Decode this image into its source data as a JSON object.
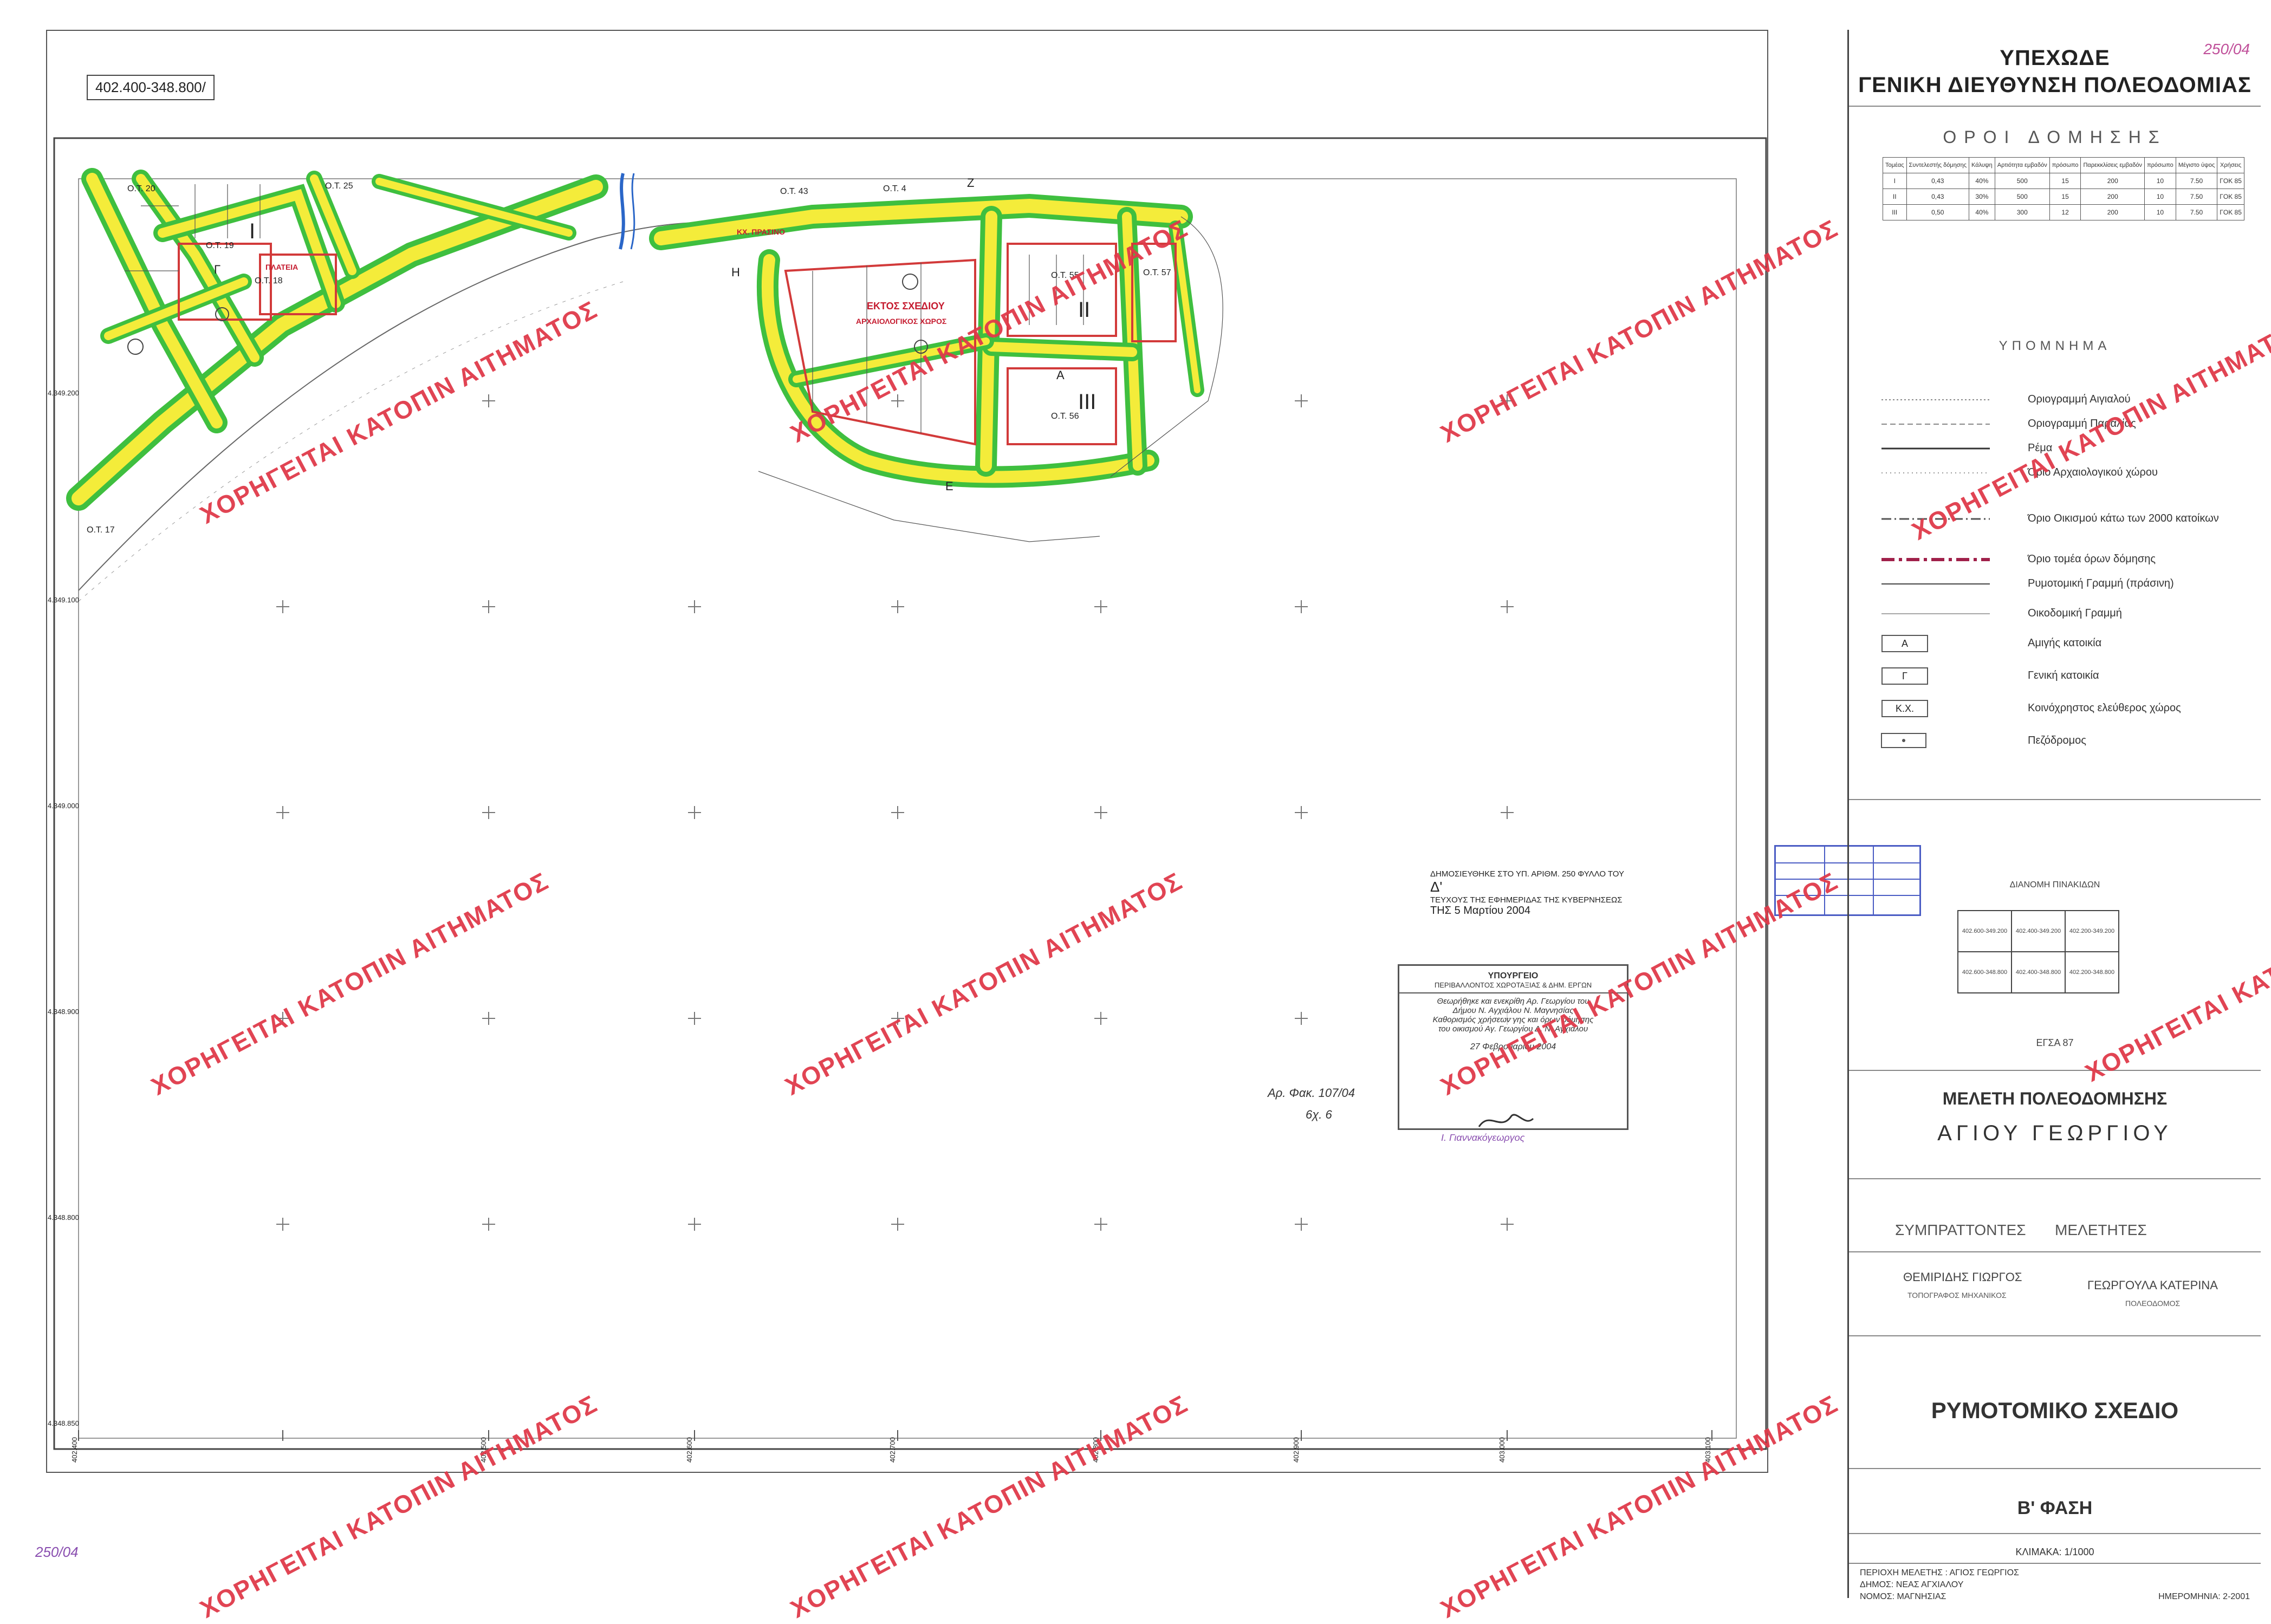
{
  "map_sheet": {
    "coord_ref": "402.400-348.800/",
    "lat_ticks": [
      "4.349.100",
      "4.349.200",
      "4.349.000",
      "4.348.900",
      "4.348.800",
      "4.348.850"
    ],
    "lon_ticks": [
      "402.400",
      "402.500",
      "402.600",
      "402.700",
      "402.800",
      "402.900",
      "403.000",
      "403.100"
    ],
    "block_labels": [
      "Ο.Τ. 20",
      "Ο.Τ. 25",
      "Ο.Τ. 19",
      "Ο.Τ. 18",
      "Ο.Τ. 17",
      "Ο.Τ. 43",
      "Ο.Τ. 55",
      "Ο.Τ. 56",
      "Ο.Τ. 57",
      "Ο.Τ. 4"
    ],
    "zone_letters": [
      "Ι",
      "Γ",
      "Η",
      "ΙΙ",
      "ΙΙΙ",
      "Α",
      "Ε",
      "Ζ"
    ],
    "red_labels": [
      "ΕΚΤΟΣ ΣΧΕΔΙΟΥ",
      "ΑΡΧΑΙΟΛΟΓΙΚΟΣ ΧΩΡΟΣ",
      "ΠΛΑΤΕΙΑ",
      "ΚΧ. ΠΡΑΣΙΝΟ"
    ],
    "pencil_note": "Αρ. Φακ. 107/04",
    "pencil_note2": "6χ. 6",
    "corner_ref": "250/04",
    "top_ref": "250/04"
  },
  "approval_stamp": {
    "ministry": "ΥΠΟΥΡΓΕΙΟ",
    "department": "ΠΕΡΙΒΑΛΛΟΝΤΟΣ ΧΩΡΟΤΑΞΙΑΣ & ΔΗΜ. ΕΡΓΩΝ",
    "line1": "Θεωρήθηκε και ενεκρίθη Αρ. Γεωργίου του",
    "line2": "Δήμου Ν. Αγχιάλου Ν. Μαγνησίας",
    "line3": "Καθορισμός χρήσεων γης και όρων δόμησης",
    "line4": "του οικισμού Αγ. Γεωργίου Δ. Ν. Αγχιάλου",
    "date": "27 Φεβρουαρίου 2004",
    "signatory": "Ι. Γιαννακόγεωργος",
    "published": "ΔΗΜΟΣΙΕΥΘΗΚΕ ΣΤΟ ΥΠ. ΑΡΙΘΜ. 250 ΦΥΛΛΟ ΤΟΥ",
    "published2": "ΤΕΥΧΟΥΣ ΤΗΣ ΕΦΗΜΕΡΙΔΑΣ ΤΗΣ ΚΥΒΕΡΝΗΣΕΩΣ",
    "published3": "ΤΗΣ 5 Μαρτίου 2004",
    "issue": "Δ'"
  },
  "title_block": {
    "org": "ΥΠΕΧΩΔΕ",
    "org_sub": "ΓΕΝΙΚΗ ΔΙΕΥΘΥΝΣΗ ΠΟΛΕΟΔΟΜΙΑΣ",
    "ref": "250/04",
    "terms_title": "ΟΡΟΙ ΔΟΜΗΣΗΣ",
    "terms_headers": [
      "Τομέας",
      "Συντελεστής δόμησης",
      "Κάλυψη",
      "Αρτιότητα εμβαδόν",
      "πρόσωπο",
      "Παρεκκλίσεις εμβαδόν",
      "πρόσωπο",
      "Μέγιστο ύψος",
      "Χρήσεις"
    ],
    "terms_rows": [
      [
        "Ι",
        "0,43",
        "40%",
        "500",
        "15",
        "200",
        "10",
        "7.50",
        "ΓΟΚ 85"
      ],
      [
        "ΙΙ",
        "0,43",
        "30%",
        "500",
        "15",
        "200",
        "10",
        "7.50",
        "ΓΟΚ 85"
      ],
      [
        "ΙΙΙ",
        "0,50",
        "40%",
        "300",
        "12",
        "200",
        "10",
        "7.50",
        "ΓΟΚ 85"
      ]
    ],
    "legend_title": "ΥΠΟΜΝΗΜΑ",
    "legend": [
      "Οριογραμμή Αιγιαλού",
      "Οριογραμμή Παραλίας",
      "Ρέμα",
      "Όριο Αρχαιολογικού χώρου",
      "Όριο Οικισμού κάτω των 2000 κατοίκων",
      "Όριο τομέα όρων δόμησης",
      "Ρυμοτομική Γραμμή (πράσινη)",
      "Οικοδομική Γραμμή",
      "Αμιγής κατοικία",
      "Γενική κατοικία",
      "Κοινόχρηστος ελεύθερος χώρος",
      "Πεζόδρομος"
    ],
    "legend_boxes": [
      "Α",
      "Γ",
      "Κ.Χ."
    ],
    "index_title": "ΔΙΑΝΟΜΗ ΠΙΝΑΚΙΔΩΝ",
    "index_cells": [
      [
        "402.600-349.200",
        "402.400-349.200",
        "402.200-349.200"
      ],
      [
        "402.600-348.800",
        "402.400-348.800",
        "402.200-348.800"
      ]
    ],
    "egsa": "ΕΓΣΑ 87",
    "study_title": "ΜΕΛΕΤΗ ΠΟΛΕΟΔΟΜΗΣΗΣ",
    "study_place": "ΑΓΙΟΥ ΓΕΩΡΓΙΟΥ",
    "col1": "ΣΥΜΠΡΑΤΤΟΝΤΕΣ",
    "col2": "ΜΕΛΕΤΗΤΕΣ",
    "person1": "ΘΕΜΙΡΙΔΗΣ ΓΙΩΡΓΟΣ",
    "role1": "ΤΟΠΟΓΡΑΦΟΣ ΜΗΧΑΝΙΚΟΣ",
    "person2": "ΓΕΩΡΓΟΥΛΑ ΚΑΤΕΡΙΝΑ",
    "role2": "ΠΟΛΕΟΔΟΜΟΣ",
    "plan_title": "ΡΥΜΟΤΟΜΙΚΟ ΣΧΕΔΙΟ",
    "phase": "Β' ΦΑΣΗ",
    "scale": "ΚΛΙΜΑΚΑ: 1/1000",
    "area": "ΠΕΡΙΟΧΗ ΜΕΛΕΤΗΣ : ΑΓΙΟΣ ΓΕΩΡΓΙΟΣ",
    "municipality": "ΔΗΜΟΣ: ΝΕΑΣ ΑΓΧΙΑΛΟΥ",
    "prefecture": "ΝΟΜΟΣ: ΜΑΓΝΗΣΙΑΣ",
    "date": "ΗΜΕΡΟΜΗΝΙΑ: 2-2001"
  },
  "watermark_text": "ΧΟΡΗΓΕΙΤΑΙ ΚΑΤΟΠΙΝ ΑΙΤΗΜΑΤΟΣ",
  "colors": {
    "road_yellow": "#f4ec3a",
    "road_green": "#3fbf3f",
    "block_red": "#d23a3a",
    "stream_blue": "#2a66c8",
    "watermark": "#e03a4a",
    "stamp_blue": "#4a5cc4"
  }
}
